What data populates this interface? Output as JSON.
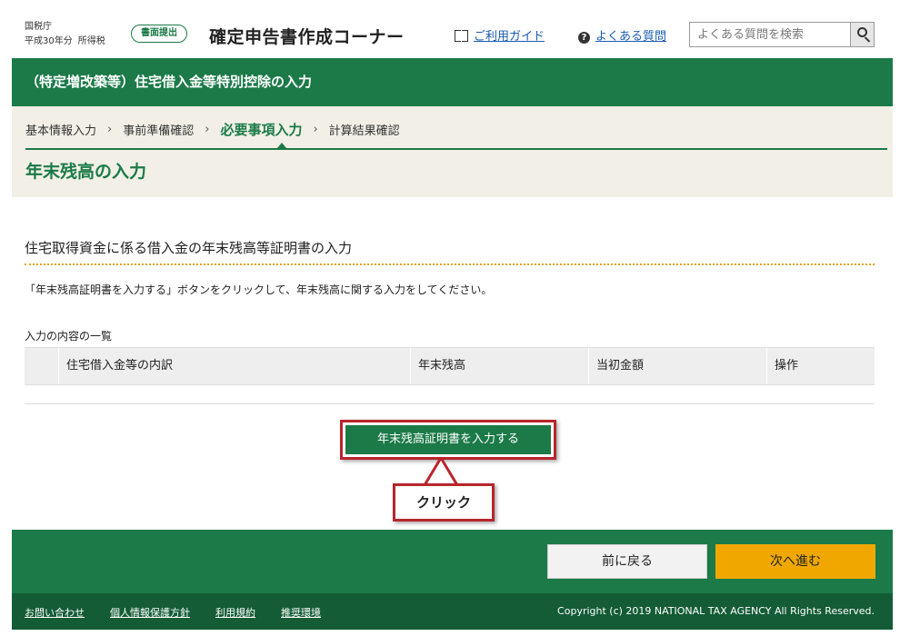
{
  "header": {
    "agency": "国税庁",
    "year": "平成30年分",
    "tax_type": "所得税",
    "submit_badge": "書面提出",
    "site_title": "確定申告書作成コーナー",
    "guide_link": "ご利用ガイド",
    "faq_link": "よくある質問",
    "search_placeholder": "よくある質問を検索",
    "icons": {
      "guide": "book-icon",
      "faq": "question-circle-icon",
      "search": "search-icon"
    }
  },
  "title_bar": {
    "text": "（特定増改築等）住宅借入金等特別控除の入力"
  },
  "steps": {
    "items": [
      "基本情報入力",
      "事前準備確認",
      "必要事項入力",
      "計算結果確認"
    ],
    "current_index": 2,
    "separator": "›"
  },
  "page_title": "年末残高の入力",
  "section": {
    "title": "住宅取得資金に係る借入金の年末残高等証明書の入力",
    "instruction": "「年末残高証明書を入力する」ボタンをクリックして、年末残高に関する入力をしてください。",
    "list_label": "入力の内容の一覧"
  },
  "table": {
    "headers": [
      "",
      "住宅借入金等の内訳",
      "年末残高",
      "当初金額",
      "操作"
    ],
    "rows": []
  },
  "cert_button": "年末残高証明書を入力する",
  "callout": "クリック",
  "nav": {
    "back": "前に戻る",
    "next": "次へ進む"
  },
  "footer": {
    "links": [
      "お問い合わせ",
      "個人情報保護方針",
      "利用規約",
      "推奨環境"
    ],
    "copyright": "Copyright (c) 2019 NATIONAL TAX AGENCY All Rights Reserved."
  },
  "colors": {
    "primary_green": "#1b7a48",
    "footer_green": "#135c35",
    "step_background": "#f2f0e6",
    "next_button": "#f0a800",
    "highlight_red": "#b8262c",
    "divider_orange": "#e8a21a",
    "link_blue": "#1a5cb0"
  }
}
